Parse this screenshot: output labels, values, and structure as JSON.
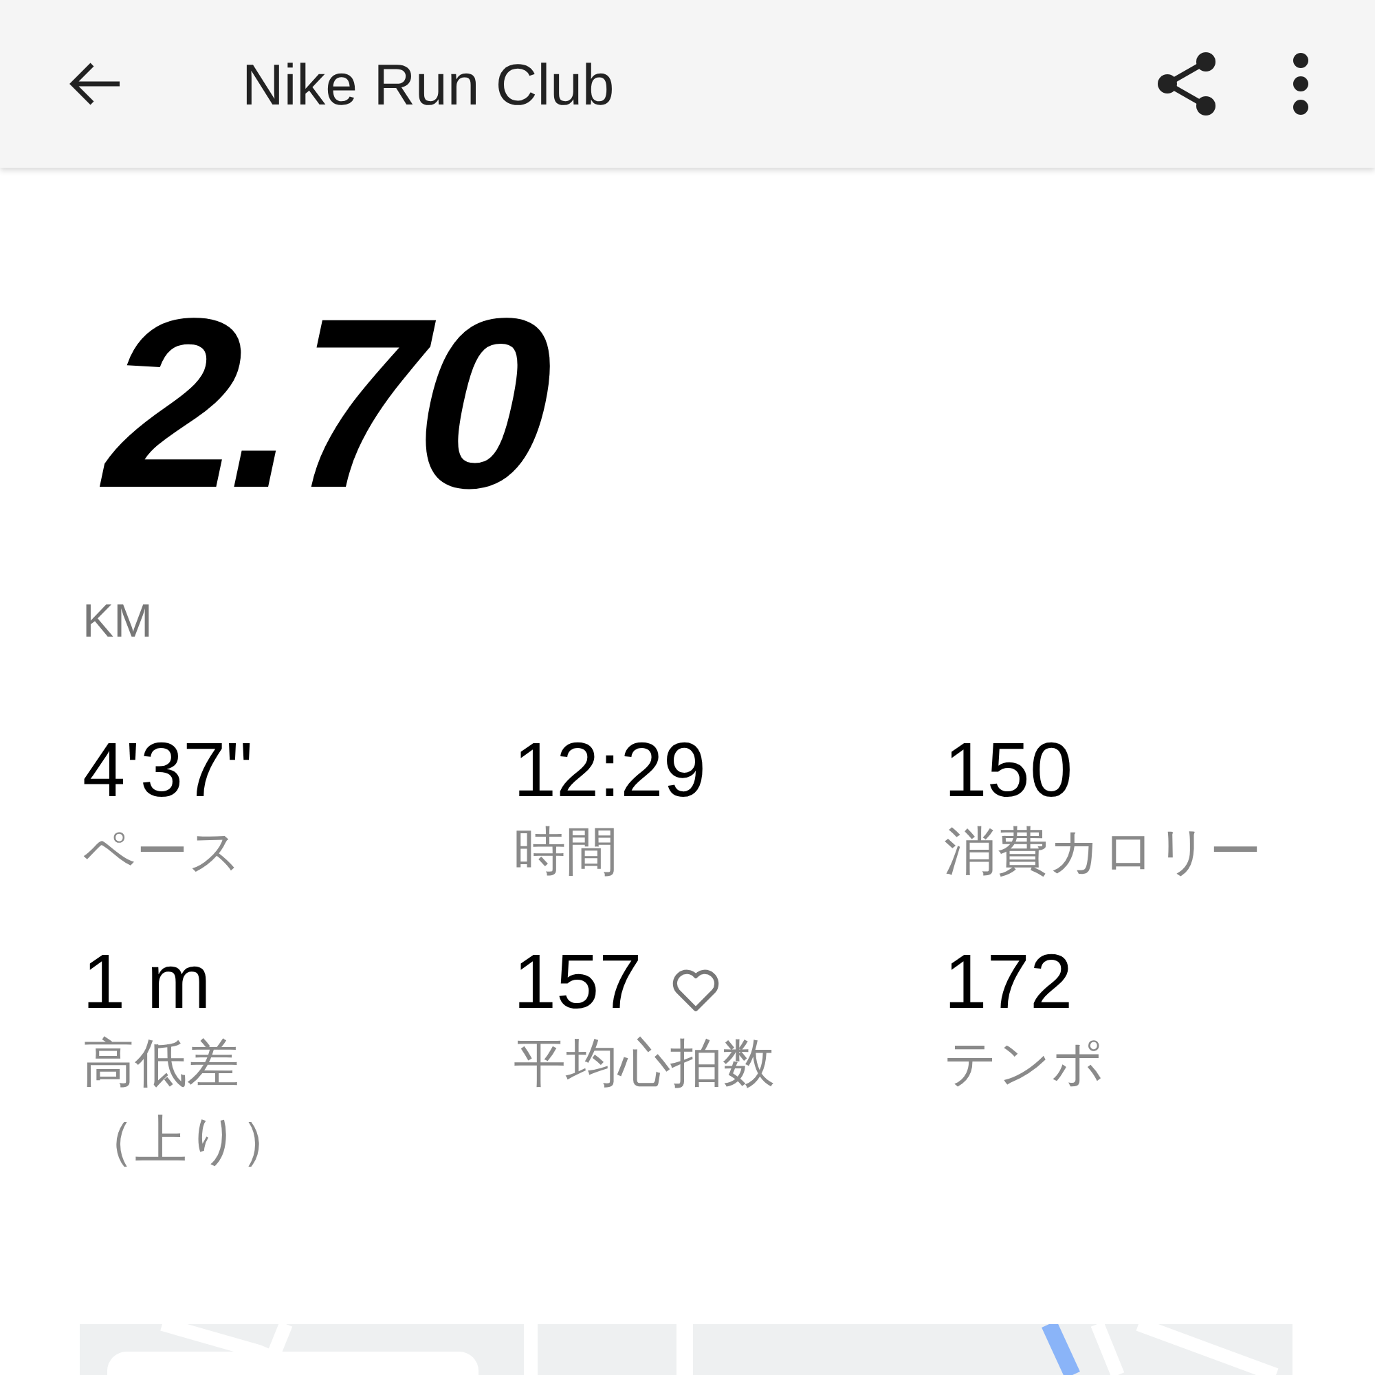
{
  "app_bar": {
    "title": "Nike Run Club"
  },
  "distance": {
    "value": "2.70",
    "unit": "KM"
  },
  "stats": [
    {
      "value": "4'37\"",
      "label": "ペース"
    },
    {
      "value": "12:29",
      "label": "時間"
    },
    {
      "value": "150",
      "label": "消費カロリー"
    },
    {
      "value": "1 m",
      "label": "高低差（上り）"
    },
    {
      "value": "157",
      "label": "平均心拍数",
      "kind": "heart"
    },
    {
      "value": "172",
      "label": "テンポ"
    }
  ]
}
